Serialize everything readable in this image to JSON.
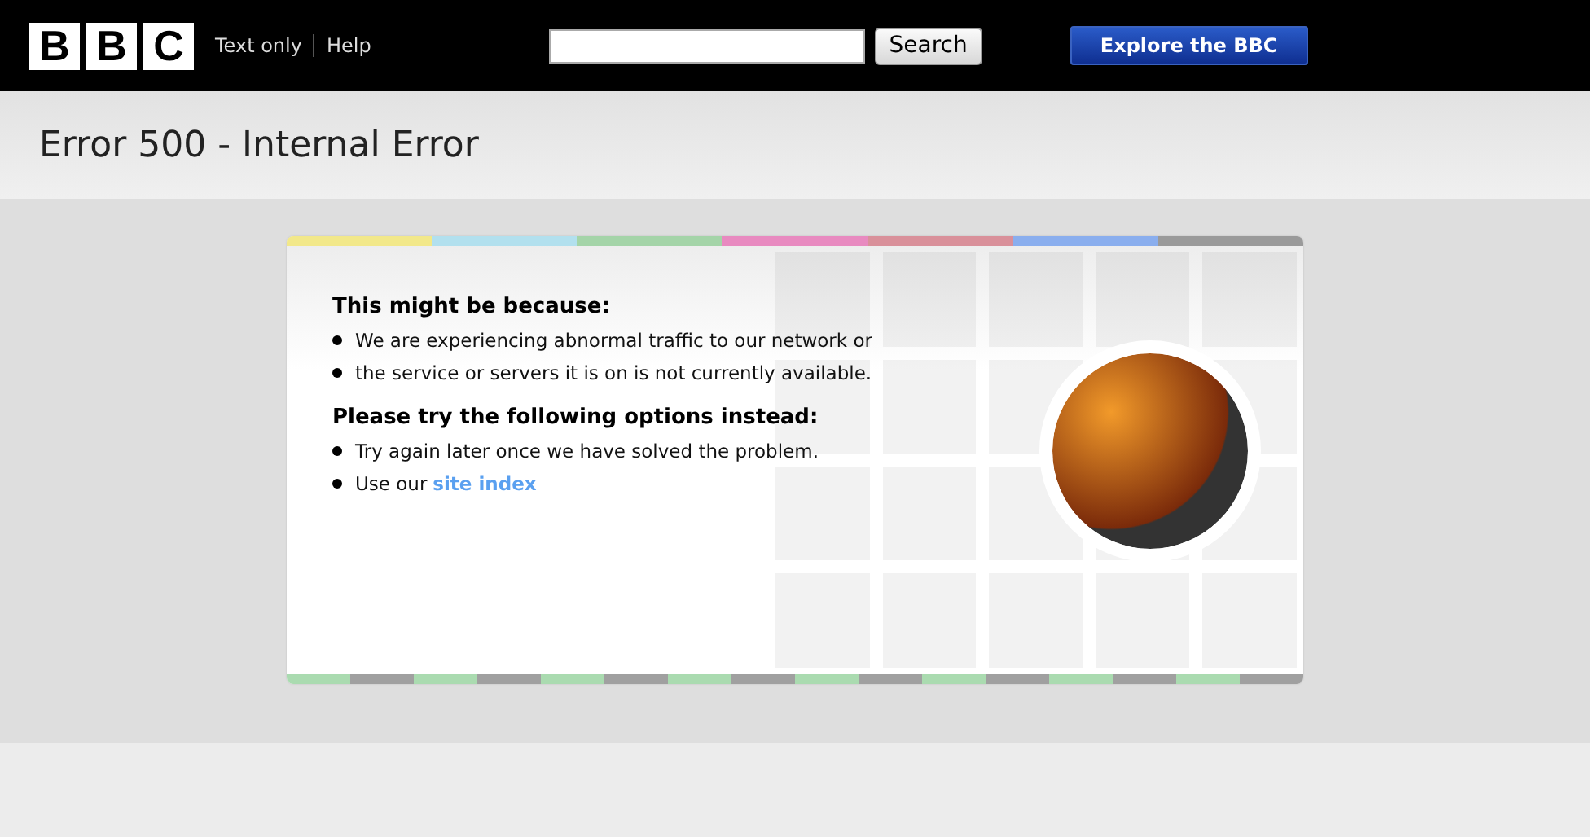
{
  "header": {
    "logo_letters": [
      "B",
      "B",
      "C"
    ],
    "links": [
      "Text only",
      "Help"
    ],
    "search_button": "Search",
    "explore_button": "Explore the BBC"
  },
  "page_title": "Error 500 - Internal Error",
  "card": {
    "top_stripe": [
      {
        "color": "#f2e88a"
      },
      {
        "color": "#b2e0ee"
      },
      {
        "color": "#a4d4a8"
      },
      {
        "color": "#e88ac0"
      },
      {
        "color": "#d9909a"
      },
      {
        "color": "#8aaeee"
      },
      {
        "color": "#9a9a9a"
      }
    ],
    "sections": [
      {
        "heading": "This might be because:",
        "items": [
          {
            "text": "We are experiencing abnormal traffic to our network or"
          },
          {
            "text": "the service or servers it is on is not currently available."
          }
        ]
      },
      {
        "heading": "Please try the following options instead:",
        "items": [
          {
            "text": "Try again later once we have solved the problem."
          },
          {
            "text": "Use our",
            "link": "site index"
          }
        ]
      }
    ],
    "bottom_stripe": [
      {
        "color": "#aadbb0"
      },
      {
        "color": "#a0a0a0"
      },
      {
        "color": "#aadbb0"
      },
      {
        "color": "#a0a0a0"
      },
      {
        "color": "#aadbb0"
      },
      {
        "color": "#a0a0a0"
      },
      {
        "color": "#aadbb0"
      },
      {
        "color": "#a0a0a0"
      },
      {
        "color": "#aadbb0"
      },
      {
        "color": "#a0a0a0"
      },
      {
        "color": "#aadbb0"
      },
      {
        "color": "#a0a0a0"
      },
      {
        "color": "#aadbb0"
      },
      {
        "color": "#a0a0a0"
      },
      {
        "color": "#aadbb0"
      },
      {
        "color": "#a0a0a0"
      }
    ]
  }
}
